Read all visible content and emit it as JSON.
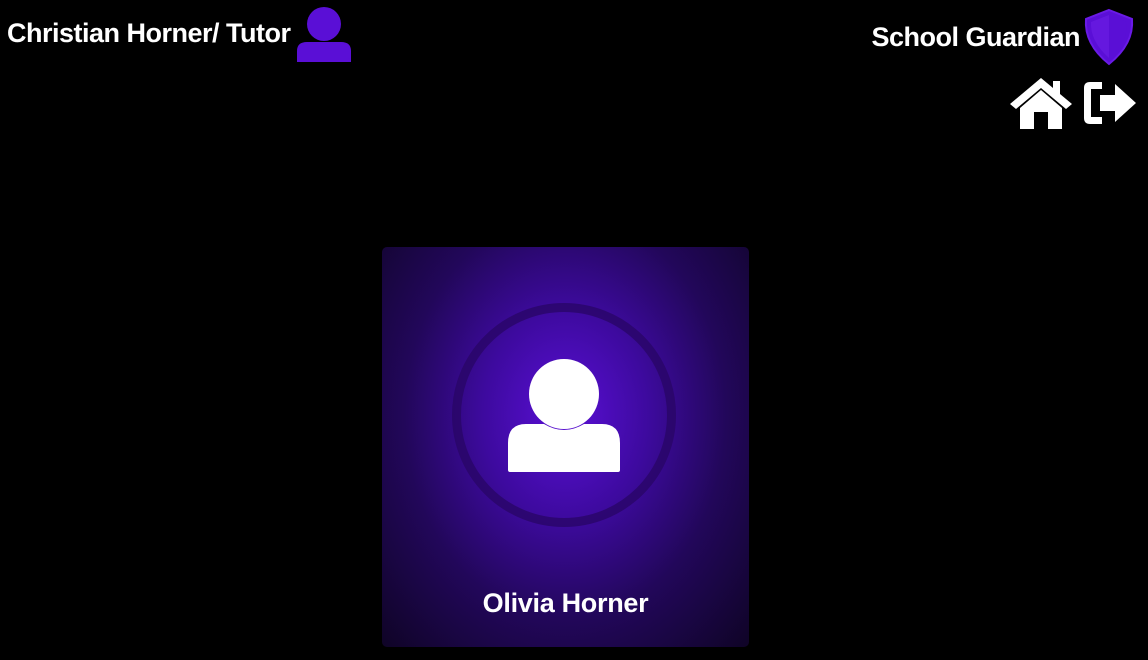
{
  "header": {
    "user_label": "Christian Horner/ Tutor",
    "user_icon": "user-icon",
    "app_name": "School Guardian",
    "app_icon": "shield-icon"
  },
  "nav": {
    "home_icon": "home-icon",
    "logout_icon": "logout-icon"
  },
  "students": [
    {
      "name": "Olivia Horner",
      "icon": "user-icon"
    }
  ],
  "colors": {
    "accent": "#5a0fd6",
    "background": "#000000",
    "text": "#ffffff"
  }
}
